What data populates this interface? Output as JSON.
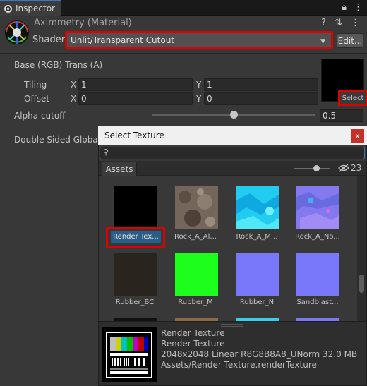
{
  "tab": {
    "label": "Inspector"
  },
  "header": {
    "material_name": "Aximmetry (Material)",
    "shader_label": "Shader",
    "shader_value": "Unlit/Transparent Cutout",
    "edit_label": "Edit..."
  },
  "props": {
    "base_label": "Base (RGB) Trans (A)",
    "tiling_label": "Tiling",
    "offset_label": "Offset",
    "x_label": "X",
    "y_label": "Y",
    "tiling_x": "1",
    "tiling_y": "1",
    "offset_x": "0",
    "offset_y": "0",
    "select_label": "Select",
    "alpha_label": "Alpha cutoff",
    "alpha_value": "0.5",
    "alpha_level": 0.5,
    "double_sided_label": "Double Sided Global Illumination"
  },
  "picker": {
    "title": "Select Texture",
    "close_label": "x",
    "assets_tab": "Assets",
    "hidden_count": "23",
    "items": [
      {
        "label": "Render Tex...",
        "color": "#000000"
      },
      {
        "label": "Rock_A_Al...",
        "color": "#7a6a5e"
      },
      {
        "label": "Rock_A_M...",
        "color": "#2ad4f0"
      },
      {
        "label": "Rock_A_No...",
        "color": "#8a7ff0"
      },
      {
        "label": "Rubber_BC",
        "color": "#2a2520"
      },
      {
        "label": "Rubber_M",
        "color": "#1cff1c"
      },
      {
        "label": "Rubber_N",
        "color": "#7a78fa"
      },
      {
        "label": "Sandblast...",
        "color": "#7a78fa"
      }
    ],
    "preview": {
      "name": "Render Texture",
      "type": "Render Texture",
      "info": "2048x2048 Linear  R8G8B8A8_UNorm  32.0 MB",
      "path": "Assets/Render Texture.renderTexture"
    }
  }
}
